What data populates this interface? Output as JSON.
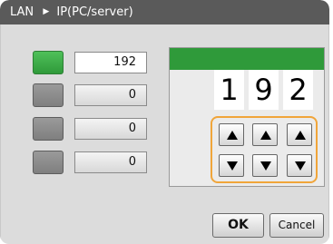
{
  "title": {
    "left": "LAN",
    "separator_icon": "right-triangle-icon",
    "right": "IP(PC/server)"
  },
  "octets": [
    {
      "value": "192",
      "active": true
    },
    {
      "value": "0",
      "active": false
    },
    {
      "value": "0",
      "active": false
    },
    {
      "value": "0",
      "active": false
    }
  ],
  "digits": [
    "1",
    "9",
    "2"
  ],
  "spin_icons": {
    "up": "up-triangle-icon",
    "down": "down-triangle-icon"
  },
  "buttons": {
    "ok": "OK",
    "cancel": "Cancel"
  },
  "colors": {
    "accent_green": "#2f9a3a",
    "highlight_orange": "#f0a53a",
    "title_bar": "#5a5a5a"
  }
}
